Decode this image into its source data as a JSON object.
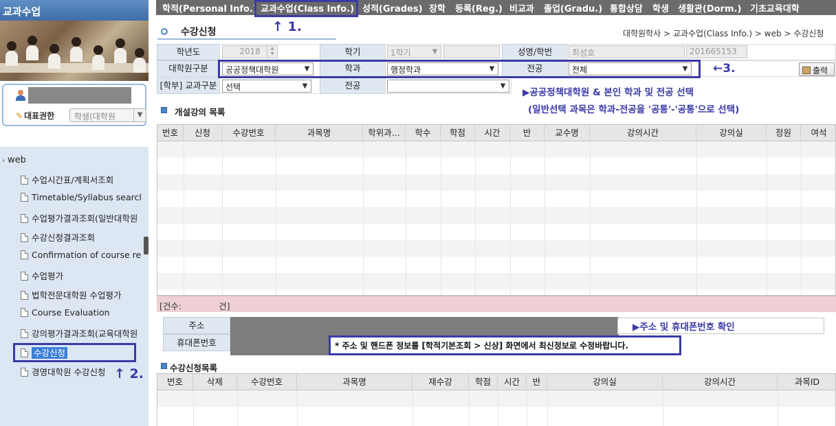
{
  "sidebar": {
    "header": "교과수업",
    "rep_auth_label": "대표권한",
    "rep_auth_value": "학생(대학원",
    "tree_root": "web",
    "items": [
      "수업시간표/계획서조회",
      "Timetable/Syllabus searcl",
      "수업평가결과조회(일반대학원",
      "수강신청결과조회",
      "Confirmation of course re",
      "수업평가",
      "법학전문대학원 수업평가",
      "Course Evaluation",
      "강의평가결과조회(교육대학원",
      "수강신청",
      "경영대학원 수강신청"
    ]
  },
  "topnav": [
    "학적(Personal Info.)",
    "교과수업(Class Info.)",
    "성적(Grades)",
    "장학",
    "등록(Reg.)",
    "비교과",
    "졸업(Gradu.)",
    "통합상담",
    "학생",
    "생활관(Dorm.)",
    "기초교육대학"
  ],
  "page": {
    "title": "수강신청",
    "breadcrumb": "대학원학사 > 교과수업(Class Info.) > web > 수강신청"
  },
  "form": {
    "year_label": "학년도",
    "year_value": "2018",
    "semester_label": "학기",
    "semester_value": "1학기",
    "name_id_label": "성명/학번",
    "name_value": "최성호",
    "id_value": "201665153",
    "grad_school_label": "대학원구분",
    "grad_school_value": "공공정책대학원",
    "dept_label": "학과",
    "dept_value": "행정학과",
    "major_label": "전공",
    "major_value": "전체",
    "undergrad_label": "[학부] 교과구분",
    "undergrad_value": "선택",
    "major2_label": "전공",
    "major2_value": "",
    "print_label": "출력"
  },
  "annotations": {
    "step1": "↑ 1.",
    "step2": "↑ 2.",
    "step3": "←3.",
    "select_note": "▶공공정책대학원 & 본인 학과 및 전공 선택",
    "select_note2": "(일반선택 과목은 학과-전공을 '공통'-'공통'으로 선택)",
    "address_note": "▶주소 및 휴대폰번호 확인",
    "update_note": "* 주소 및 핸드폰 정보를 [학적기본조회 > 신상] 화면에서 최신정보로 수정바랍니다."
  },
  "open_courses": {
    "title": "개설강의 목록",
    "columns": [
      "번호",
      "신청",
      "수강번호",
      "과목명",
      "학위과...",
      "학수",
      "학점",
      "시간",
      "반",
      "교수명",
      "강의시간",
      "강의실",
      "정원",
      "여석"
    ],
    "count_label": "[건수:",
    "count_value": "",
    "count_suffix": "건]"
  },
  "contact": {
    "address_label": "주소",
    "phone_label": "휴대폰번호"
  },
  "registered": {
    "title": "수강신청목록",
    "columns": [
      "번호",
      "삭제",
      "수강번호",
      "과목명",
      "재수강",
      "학점",
      "시간",
      "반",
      "강의실",
      "강의시간",
      "과목ID"
    ]
  },
  "colors": {
    "nav_bg": "#6b6b6b",
    "annotation": "#3a3aa6",
    "sidebar_tree_bg": "#dde7f3",
    "count_bar_bg": "#efd1d5",
    "selected_item": "#3d7fd6"
  }
}
